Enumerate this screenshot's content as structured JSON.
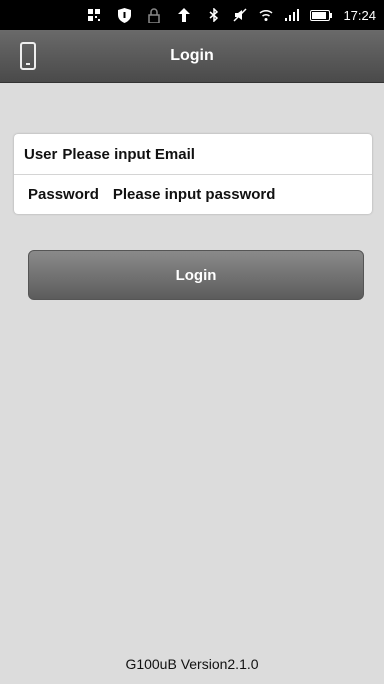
{
  "status_bar": {
    "time": "17:24",
    "icons": [
      "qr-icon",
      "shield-icon",
      "lock-icon",
      "upload-arrow-icon",
      "bluetooth-icon",
      "mute-icon",
      "wifi-icon",
      "signal-icon",
      "battery-icon"
    ]
  },
  "header": {
    "title": "Login",
    "icon": "phone-icon"
  },
  "form": {
    "user_label": "User",
    "user_placeholder": "Please input Email",
    "user_value": "",
    "password_label": "Password",
    "password_placeholder": "Please input password",
    "password_value": ""
  },
  "login_button": {
    "label": "Login"
  },
  "footer": {
    "version": "G100uB Version2.1.0"
  },
  "colors": {
    "background": "#dcdcdc",
    "titlebar": "#555555",
    "button": "#707070"
  }
}
